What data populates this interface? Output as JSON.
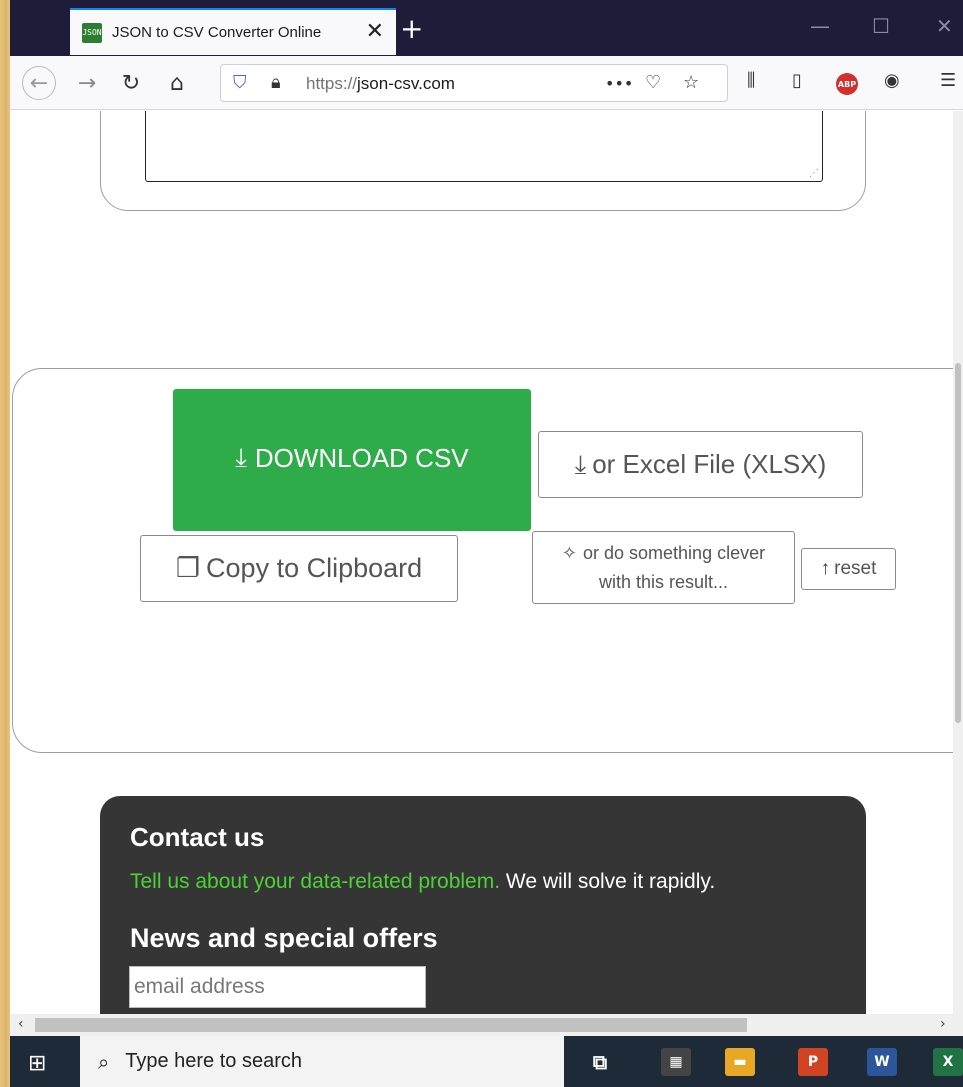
{
  "browser": {
    "tab_title": "JSON to CSV Converter Online",
    "tab_favicon_text": "JSON",
    "tab_close": "✕",
    "new_tab": "+",
    "url_scheme": "https://",
    "url_host": "json-csv.com",
    "page_actions": "•••",
    "adblock_label": "ABP",
    "accent_color": "#0a84ff"
  },
  "actions": {
    "download_csv": "DOWNLOAD CSV",
    "excel": "or Excel File (XLSX)",
    "copy": "Copy to Clipboard",
    "clever_line1": "or do something clever",
    "clever_line2": "with this result...",
    "reset": "reset",
    "download_color": "#2fac4a"
  },
  "contact": {
    "title": "Contact us",
    "line_link": "Tell us about your data-related problem.",
    "line_rest": " We will solve it rapidly.",
    "news_title": "News and special offers",
    "email_placeholder": "email address"
  },
  "taskbar": {
    "search_placeholder": "Type here to search"
  }
}
